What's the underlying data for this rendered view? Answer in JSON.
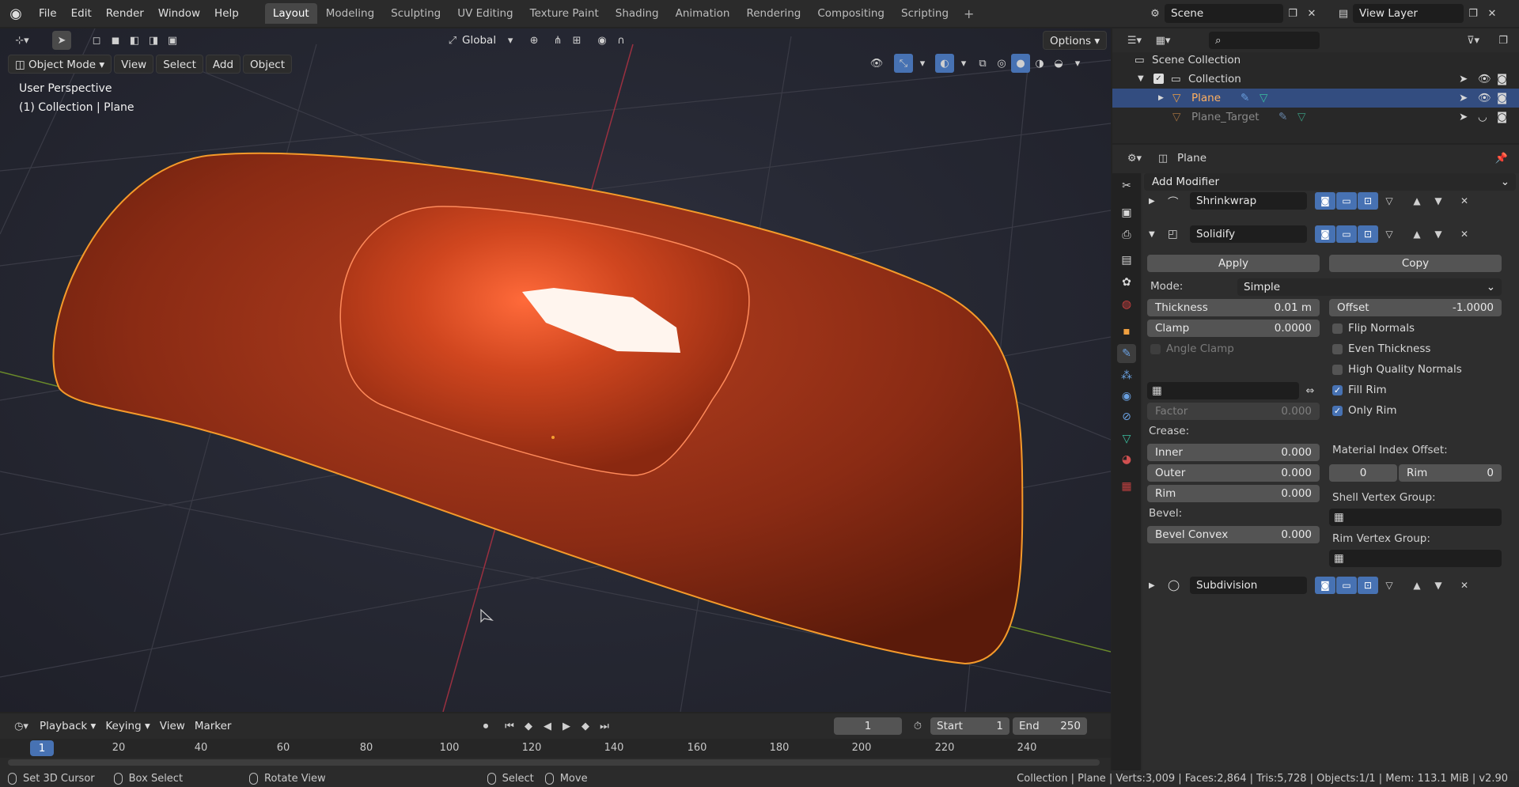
{
  "topbar": {
    "menus": [
      "File",
      "Edit",
      "Render",
      "Window",
      "Help"
    ],
    "workspaces": [
      "Layout",
      "Modeling",
      "Sculpting",
      "UV Editing",
      "Texture Paint",
      "Shading",
      "Animation",
      "Rendering",
      "Compositing",
      "Scripting"
    ],
    "active_workspace": "Layout",
    "scene": "Scene",
    "view_layer": "View Layer"
  },
  "viewport": {
    "transform_orientation": "Global",
    "options_label": "Options",
    "mode": "Object Mode",
    "menus": [
      "View",
      "Select",
      "Add",
      "Object"
    ],
    "perspective_label": "User Perspective",
    "collection_label": "(1) Collection | Plane",
    "object_color": "#c7401f",
    "selection_outline": "#f59a2a"
  },
  "timeline": {
    "menus": [
      "Playback",
      "Keying",
      "View",
      "Marker"
    ],
    "current_frame": "1",
    "start_label": "Start",
    "start": "1",
    "end_label": "End",
    "end": "250",
    "ruler_current": "1",
    "ticks": [
      "20",
      "40",
      "60",
      "80",
      "100",
      "120",
      "140",
      "160",
      "180",
      "200",
      "220",
      "240"
    ]
  },
  "statusbar": {
    "set_cursor": "Set 3D Cursor",
    "box_select": "Box Select",
    "rotate_view": "Rotate View",
    "select": "Select",
    "move": "Move",
    "stats": "Collection | Plane | Verts:3,009 | Faces:2,864 | Tris:5,728 | Objects:1/1 | Mem: 113.1 MiB | v2.90"
  },
  "outliner": {
    "scene_collection": "Scene Collection",
    "collection": "Collection",
    "items": [
      {
        "name": "Plane"
      },
      {
        "name": "Plane_Target"
      }
    ]
  },
  "properties": {
    "object_name": "Plane",
    "add_modifier": "Add Modifier",
    "modifiers": [
      {
        "name": "Shrinkwrap"
      },
      {
        "name": "Solidify"
      },
      {
        "name": "Subdivision"
      }
    ],
    "apply": "Apply",
    "copy": "Copy",
    "mode_label": "Mode:",
    "mode_value": "Simple",
    "thickness_label": "Thickness",
    "thickness_value": "0.01 m",
    "offset_label": "Offset",
    "offset_value": "-1.0000",
    "clamp_label": "Clamp",
    "clamp_value": "0.0000",
    "angle_clamp": "Angle Clamp",
    "flip_normals": "Flip Normals",
    "even_thickness": "Even Thickness",
    "high_quality_normals": "High Quality Normals",
    "fill_rim": "Fill Rim",
    "only_rim": "Only Rim",
    "factor_label": "Factor",
    "factor_value": "0.000",
    "crease_label": "Crease:",
    "inner_label": "Inner",
    "inner_value": "0.000",
    "outer_label": "Outer",
    "outer_value": "0.000",
    "rim_label": "Rim",
    "rim_value": "0.000",
    "bevel_label": "Bevel:",
    "bevel_convex_label": "Bevel Convex",
    "bevel_convex_value": "0.000",
    "material_offset_label": "Material Index Offset:",
    "material_offset_value": "0",
    "material_rim_label": "Rim",
    "material_rim_value": "0",
    "shell_vg_label": "Shell Vertex Group:",
    "rim_vg_label": "Rim Vertex Group:"
  }
}
